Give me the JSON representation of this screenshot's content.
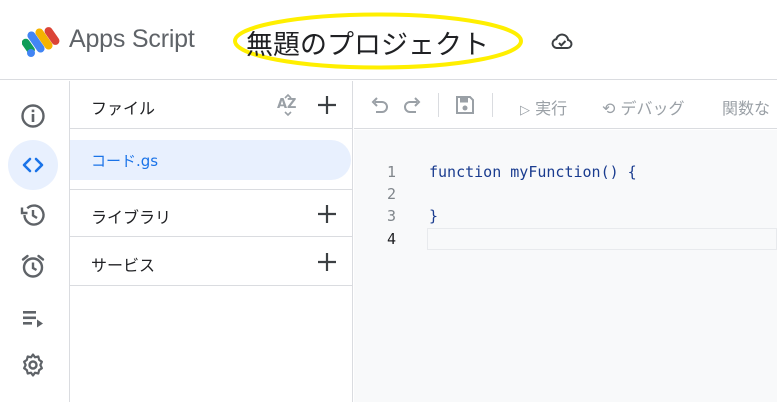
{
  "header": {
    "app_name": "Apps Script",
    "project_title": "無題のプロジェクト",
    "highlight_color": "#ffef00"
  },
  "rail": {
    "items": [
      {
        "name": "overview",
        "icon": "info-icon",
        "active": false
      },
      {
        "name": "editor",
        "icon": "code-icon",
        "active": true
      },
      {
        "name": "executions-history",
        "icon": "history-icon",
        "active": false
      },
      {
        "name": "triggers",
        "icon": "alarm-icon",
        "active": false
      },
      {
        "name": "executions",
        "icon": "playlist-play-icon",
        "active": false
      },
      {
        "name": "settings",
        "icon": "gear-icon",
        "active": false
      }
    ]
  },
  "files_panel": {
    "files_label": "ファイル",
    "files": [
      {
        "name": "コード.gs"
      }
    ],
    "libraries_label": "ライブラリ",
    "services_label": "サービス"
  },
  "toolbar": {
    "run_label": "実行",
    "debug_label": "デバッグ",
    "function_label": "関数な"
  },
  "editor": {
    "lines": [
      {
        "number": "1",
        "text": "function myFunction() {"
      },
      {
        "number": "2",
        "text": ""
      },
      {
        "number": "3",
        "text": "}"
      },
      {
        "number": "4",
        "text": ""
      }
    ]
  },
  "colors": {
    "accent": "#1a73e8",
    "active_bg": "#e8f0fe",
    "icon": "#5f6368",
    "border": "#dadce0",
    "editor_bg": "#f8f9fa"
  }
}
